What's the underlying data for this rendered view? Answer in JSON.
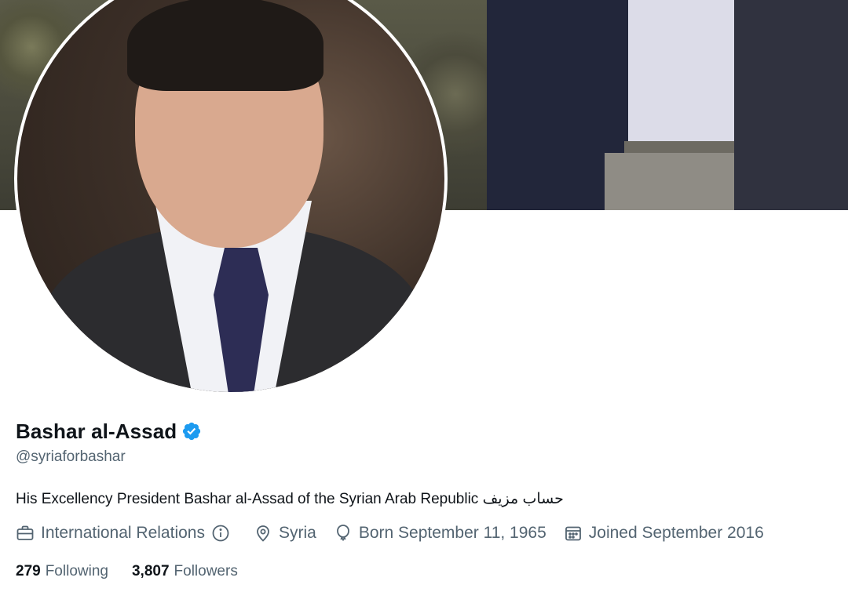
{
  "profile": {
    "name": "Bashar al-Assad",
    "handle": "@syriaforbashar",
    "bio": "His Excellency President Bashar al-Assad of the Syrian Arab Republic حساب مزيف",
    "verified": true,
    "category": "International Relations",
    "location": "Syria",
    "born": "Born September 11, 1965",
    "joined": "Joined September 2016",
    "following_count": "279",
    "following_label": "Following",
    "followers_count": "3,807",
    "followers_label": "Followers"
  },
  "icons": {
    "verified": "verified-badge-icon",
    "category": "briefcase-icon",
    "info": "info-icon",
    "location": "location-pin-icon",
    "born": "balloon-icon",
    "joined": "calendar-icon"
  },
  "colors": {
    "verified_blue": "#1d9bf0",
    "secondary_text": "#536471",
    "primary_text": "#0f1419"
  }
}
